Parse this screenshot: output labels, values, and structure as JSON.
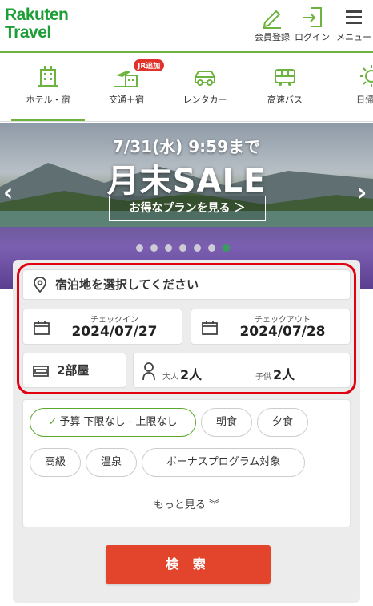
{
  "header": {
    "logo_line1": "Rakuten",
    "logo_line2": "Travel",
    "register_label": "会員登録",
    "login_label": "ログイン",
    "menu_label": "メニュー"
  },
  "tabs": [
    {
      "label": "ホテル・宿",
      "icon": "hotel-icon",
      "active": true
    },
    {
      "label": "交通＋宿",
      "icon": "flight-hotel-icon",
      "badge": "JR追加"
    },
    {
      "label": "レンタカー",
      "icon": "car-icon"
    },
    {
      "label": "高速バス",
      "icon": "bus-icon"
    },
    {
      "label": "日帰",
      "icon": "sun-icon"
    }
  ],
  "banner": {
    "date_text": "7/31(水) 9:59まで",
    "title": "月末SALE",
    "cta": "お得なプランを見る ＞",
    "slide_count": 7,
    "active_slide": 7
  },
  "search": {
    "destination_placeholder": "宿泊地を選択してください",
    "checkin_label": "チェックイン",
    "checkin_value": "2024/07/27",
    "checkout_label": "チェックアウト",
    "checkout_value": "2024/07/28",
    "rooms_value": "2部屋",
    "adult_label": "大人",
    "adult_value": "2人",
    "child_label": "子供",
    "child_value": "2人"
  },
  "filters": {
    "chips": [
      {
        "label": "予算 下限なし - 上限なし",
        "selected": true
      },
      {
        "label": "朝食"
      },
      {
        "label": "夕食"
      },
      {
        "label": "高級"
      },
      {
        "label": "温泉"
      },
      {
        "label": "ボーナスプログラム対象"
      }
    ],
    "more_label": "もっと見る"
  },
  "search_button": "検 索",
  "colors": {
    "brand_green": "#1e9e37",
    "accent_green": "#6cb33f",
    "search_red": "#e2442c",
    "highlight_red": "#e0000f"
  }
}
